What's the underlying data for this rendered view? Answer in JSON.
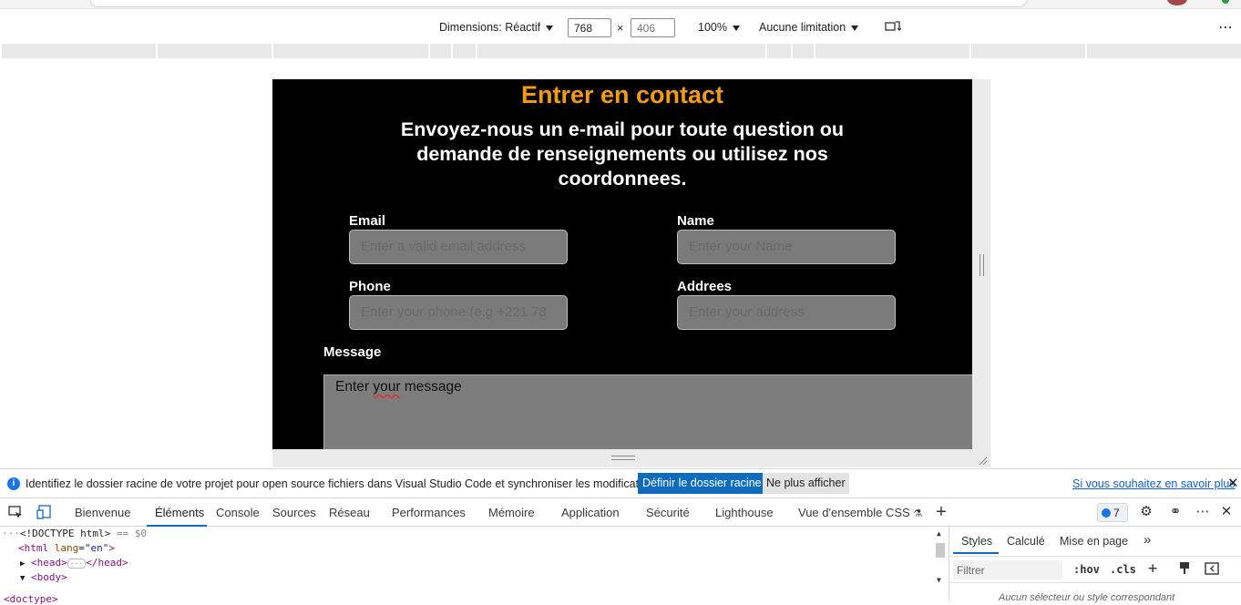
{
  "device_toolbar": {
    "dimensions_label": "Dimensions: Réactif",
    "width": "768",
    "height_placeholder": "406",
    "times": "×",
    "zoom": "100%",
    "throttle": "Aucune limitation"
  },
  "page": {
    "title": "Entrer en contact",
    "subtitle": "Envoyez-nous un e-mail pour toute question ou demande de renseignements ou utilisez nos coordonnees.",
    "form": {
      "email_label": "Email",
      "email_placeholder": "Enter a valid email address",
      "name_label": "Name",
      "name_placeholder": "Enter your Name",
      "phone_label": "Phone",
      "phone_placeholder": "Enter your phone (e.g +221 78",
      "address_label": "Addrees",
      "address_placeholder": "Enter your address",
      "message_label": "Message",
      "message_placeholder_a": "Enter ",
      "message_placeholder_b": "your",
      "message_placeholder_c": " message"
    }
  },
  "infobar": {
    "text": "Identifiez le dossier racine de votre projet pour open source fichiers dans Visual Studio Code et synchroniser les modifications.",
    "primary_button": "Définir le dossier racine",
    "secondary_button": "Ne plus afficher",
    "link": "Si vous souhaitez en savoir plus"
  },
  "devtools": {
    "tabs": [
      "Bienvenue",
      "Éléments",
      "Console",
      "Sources",
      "Réseau",
      "Performances",
      "Mémoire",
      "Application",
      "Sécurité",
      "Lighthouse",
      "Vue d'ensemble CSS"
    ],
    "active_tab": "Éléments",
    "issues_count": "7",
    "accent_color": "#0f6cbd"
  },
  "elements": {
    "doctype": "<!DOCTYPE html>",
    "selected_marker": "== $0",
    "html_open": "<html",
    "html_attr": "lang",
    "html_attr_value": "\"en\"",
    "html_close": ">",
    "head_open": "<head>",
    "head_close": "</head>",
    "body_open": "<body>",
    "cut_line": "<doctype>"
  },
  "styles_panel": {
    "tabs": [
      "Styles",
      "Calculé",
      "Mise en page"
    ],
    "filter_placeholder": "Filtrer",
    "hov": ":hov",
    "cls": ".cls",
    "no_match": "Aucun sélecteur ou style correspondant"
  },
  "colors": {
    "page_title": "#f39c12",
    "page_background": "#000000",
    "input_background": "#7a7a7a"
  }
}
